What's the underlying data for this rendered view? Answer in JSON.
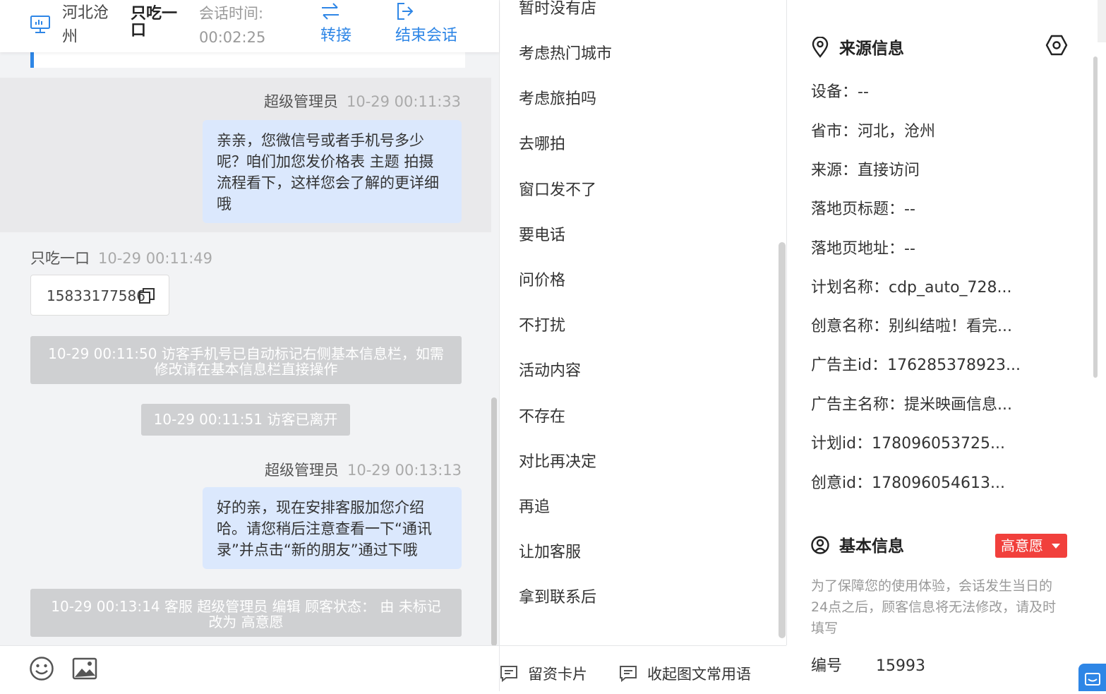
{
  "header": {
    "location": "河北沧州",
    "visitor_name": "只吃一口",
    "session_time_label": "会话时间:",
    "session_time_value": "00:02:25",
    "transfer_label": "转接",
    "end_session_label": "结束会话"
  },
  "chat": {
    "messages": [
      {
        "sender": "超级管理员",
        "time": "10-29 00:11:33",
        "text": "亲亲，您微信号或者手机号多少呢？咱们加您发价格表 主题 拍摄流程看下，这样您会了解的更详细哦"
      },
      {
        "sender": "只吃一口",
        "time": "10-29 00:11:49",
        "text": "15833177586"
      },
      {
        "sender": "超级管理员",
        "time": "10-29 00:13:13",
        "text": "好的亲，现在安排客服加您介绍哈。请您稍后注意查看一下“通讯录”并点击“新的朋友”通过下哦"
      }
    ],
    "system_notices": [
      "10-29 00:11:50 访客手机号已自动标记右侧基本信息栏，如需修改请在基本信息栏直接操作",
      "10-29 00:11:51 访客已离开",
      "10-29 00:13:14 客服 超级管理员 编辑 顾客状态： 由 未标记 改为 高意愿"
    ]
  },
  "footer": {
    "info_card_label": "留资卡片",
    "collapse_phrases_label": "收起图文常用语"
  },
  "quick_replies": [
    "暂时没有店",
    "考虑热门城市",
    "考虑旅拍吗",
    "去哪拍",
    "窗口发不了",
    "要电话",
    "问价格",
    "不打扰",
    "活动内容",
    "不存在",
    "对比再决定",
    "再追",
    "让加客服",
    "拿到联系后"
  ],
  "source_info": {
    "title": "来源信息",
    "rows": [
      "设备：--",
      "省市：河北，沧州",
      "来源：直接访问",
      "落地页标题：--",
      "落地页地址：--",
      "计划名称：cdp_auto_728...",
      "创意名称：别纠结啦！看完...",
      "广告主id：176285378923...",
      "广告主名称：提米映画信息...",
      "计划id：178096053725...",
      "创意id：178096054613..."
    ]
  },
  "basic_info": {
    "title": "基本信息",
    "intent_badge": "高意愿",
    "note": "为了保障您的使用体验，会话发生当日的24点之后，顾客信息将无法修改，请及时填写",
    "id_label": "编号",
    "id_value": "15993"
  },
  "colors": {
    "accent": "#2e86e6",
    "agent_bubble": "#dbe8fd",
    "notice_bg": "#cfd0d2",
    "badge_red": "#f1403c"
  },
  "icons": {
    "header": "monitor-icon",
    "transfer": "swap-arrows-icon",
    "end_session": "logout-icon",
    "copy": "copy-icon",
    "emoji": "emoji-icon",
    "image": "image-icon",
    "card": "message-card-icon",
    "location": "location-pin-icon",
    "settings": "hexagon-settings-icon",
    "user": "user-circle-icon"
  }
}
